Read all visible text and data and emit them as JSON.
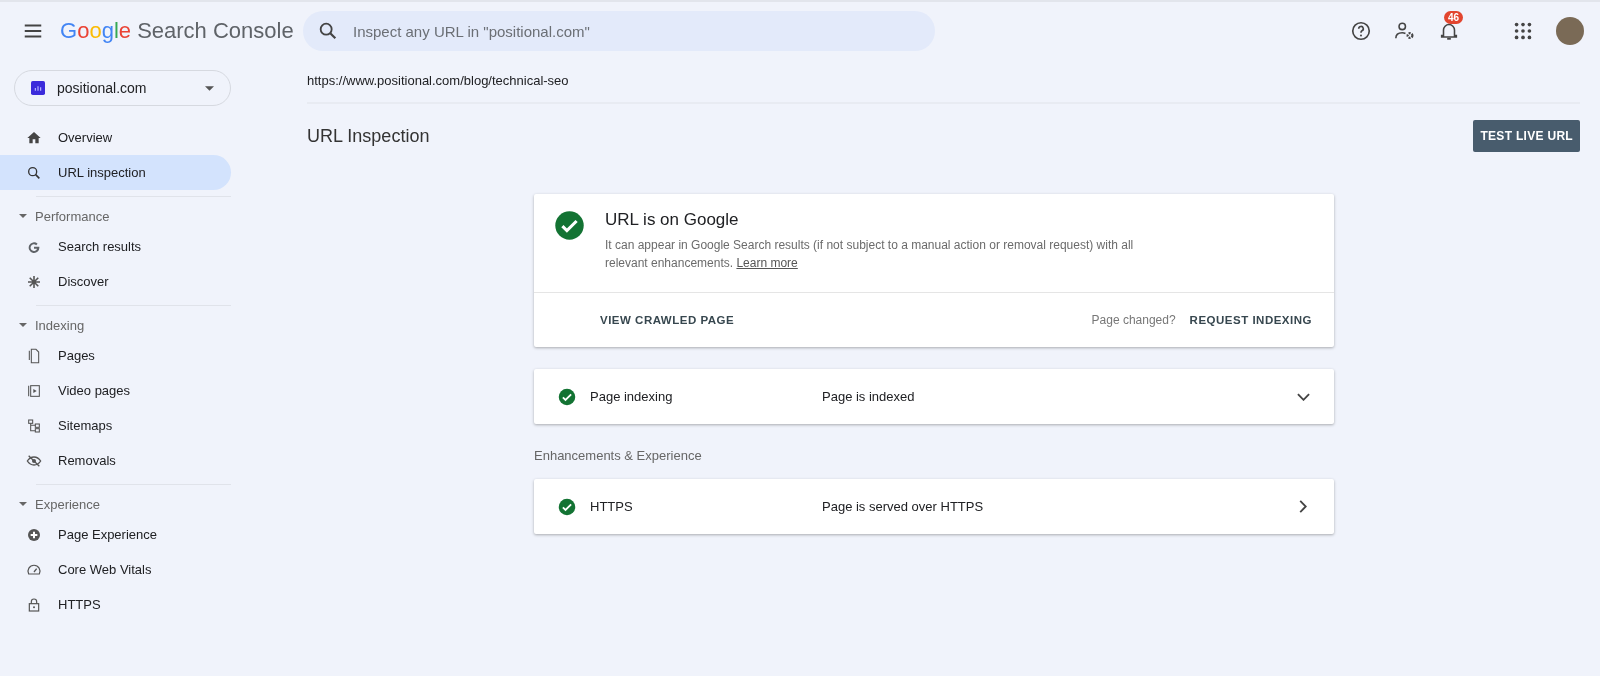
{
  "header": {
    "logo": {
      "brand": "Google",
      "product": "Search Console"
    },
    "search": {
      "placeholder": "Inspect any URL in \"positional.com\""
    },
    "notifications_badge": "46"
  },
  "sidebar": {
    "property": "positional.com",
    "items": [
      {
        "label": "Overview",
        "selected": false
      },
      {
        "label": "URL inspection",
        "selected": true
      }
    ],
    "sections": [
      {
        "heading": "Performance",
        "expanded": true,
        "items": [
          {
            "label": "Search results",
            "selected": false
          },
          {
            "label": "Discover",
            "selected": false
          }
        ]
      },
      {
        "heading": "Indexing",
        "expanded": true,
        "items": [
          {
            "label": "Pages",
            "selected": false
          },
          {
            "label": "Video pages",
            "selected": false
          },
          {
            "label": "Sitemaps",
            "selected": false
          },
          {
            "label": "Removals",
            "selected": false
          }
        ]
      },
      {
        "heading": "Experience",
        "expanded": true,
        "items": [
          {
            "label": "Page Experience",
            "selected": false
          },
          {
            "label": "Core Web Vitals",
            "selected": false
          },
          {
            "label": "HTTPS",
            "selected": false
          }
        ]
      }
    ]
  },
  "main": {
    "url": "https://www.positional.com/blog/technical-seo",
    "title": "URL Inspection",
    "test_button": "TEST LIVE URL",
    "status_card": {
      "title": "URL is on Google",
      "description": "It can appear in Google Search results (if not subject to a manual action or removal request) with all relevant enhancements.",
      "link": "Learn more",
      "view_button": "VIEW CRAWLED PAGE",
      "question": "Page changed?",
      "request_button": "REQUEST INDEXING"
    },
    "coverage": [
      {
        "kind": "expandable",
        "label": "Page indexing",
        "value": "Page is indexed",
        "expanded": false
      }
    ],
    "enhancements_heading": "Enhancements & Experience",
    "enhancements": [
      {
        "kind": "link",
        "label": "HTTPS",
        "value": "Page is served over HTTPS"
      }
    ]
  }
}
